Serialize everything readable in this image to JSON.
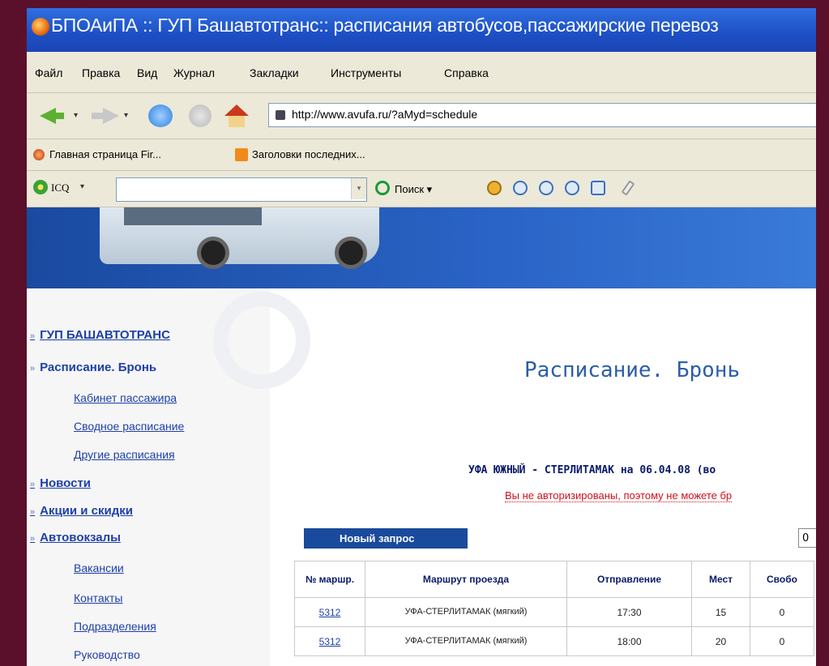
{
  "window": {
    "title": "БПОАиПА :: ГУП Башавтотранс:: расписания автобусов,пассажирские перевоз"
  },
  "menu": [
    "Файл",
    "Правка",
    "Вид",
    "Журнал",
    "Закладки",
    "Инструменты",
    "Справка"
  ],
  "nav": {
    "url": "http://www.avufa.ru/?aMyd=schedule"
  },
  "bookmarks": [
    "Главная страница Fir...",
    "Заголовки последних..."
  ],
  "toolbar": {
    "icq_label": "ICQ",
    "search_label": "Поиск"
  },
  "sidebar": {
    "items": [
      {
        "label": "ГУП БАШАВТОТРАНС"
      },
      {
        "label": "Расписание. Бронь"
      },
      {
        "label": "Новости"
      },
      {
        "label": "Акции и скидки"
      },
      {
        "label": "Автовокзалы"
      }
    ],
    "sub_schedule": [
      "Кабинет пассажира",
      "Сводное расписание",
      "Другие расписания"
    ],
    "sub_stations": [
      "Вакансии",
      "Контакты",
      "Подразделения",
      "Руководство"
    ]
  },
  "main": {
    "title": "Расписание. Бронь",
    "route_heading": "УФА ЮЖНЫЙ - СТЕРЛИТАМАК на 06.04.08 (во",
    "auth_message": "Вы не авторизированы, поэтому не можете бр",
    "new_request_label": "Новый запрос",
    "pager_value": "0"
  },
  "table": {
    "headers": [
      "№ маршр.",
      "Маршрут проезда",
      "Отправление",
      "Мест",
      "Свобо"
    ],
    "rows": [
      {
        "num": "5312",
        "route": "УФА-СТЕРЛИТАМАК (мягкий)",
        "depart": "17:30",
        "seats": "15",
        "free": "0"
      },
      {
        "num": "5312",
        "route": "УФА-СТЕРЛИТАМАК (мягкий)",
        "depart": "18:00",
        "seats": "20",
        "free": "0"
      }
    ]
  }
}
